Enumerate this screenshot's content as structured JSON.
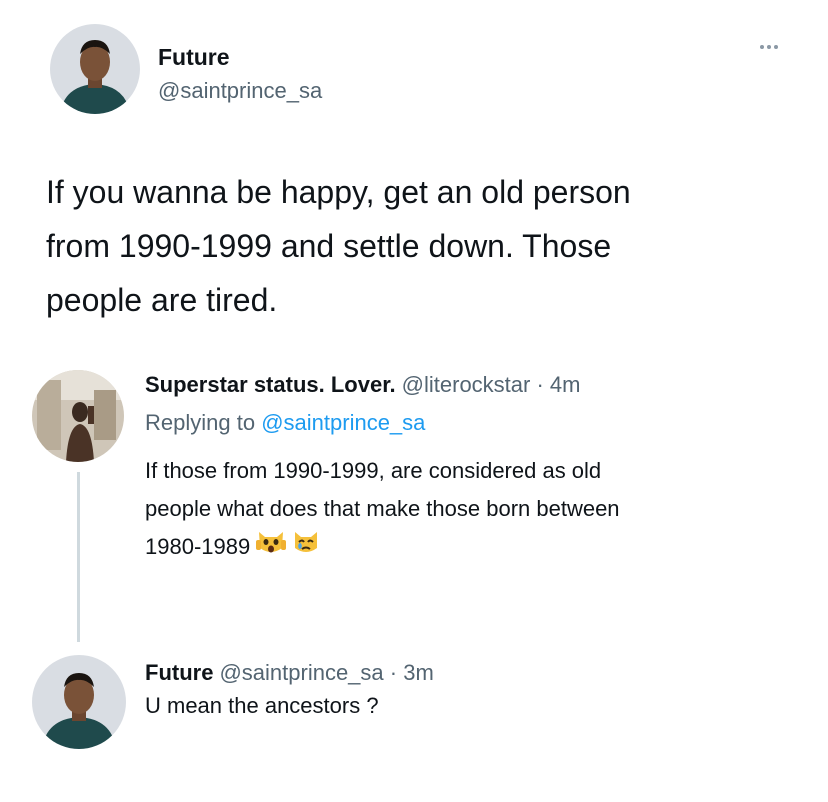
{
  "main_tweet": {
    "author_name": "Future",
    "author_handle": "@saintprince_sa",
    "text_lines": [
      "If you wanna be happy, get an old person",
      "from 1990-1999 and settle down. Those",
      "people are tired."
    ]
  },
  "reply_1": {
    "author_name": "Superstar status. Lover.",
    "author_handle": "@literockstar",
    "time": "· 4m",
    "replying_prefix": "Replying to",
    "replying_handle": "@saintprince_sa",
    "text_lines": [
      "If those from 1990-1999, are considered as old",
      "people what does that make those born between",
      "1980-1989"
    ],
    "emojis": [
      "face-screaming-cat-emoji",
      "crying-cat-emoji"
    ]
  },
  "reply_2": {
    "author_name": "Future",
    "author_handle": "@saintprince_sa",
    "time": "· 3m",
    "text": "U mean the ancestors ?"
  },
  "colors": {
    "text": "#0f1419",
    "secondary": "#536471",
    "link": "#1d9bf0",
    "thread_line": "#cfd9de"
  }
}
